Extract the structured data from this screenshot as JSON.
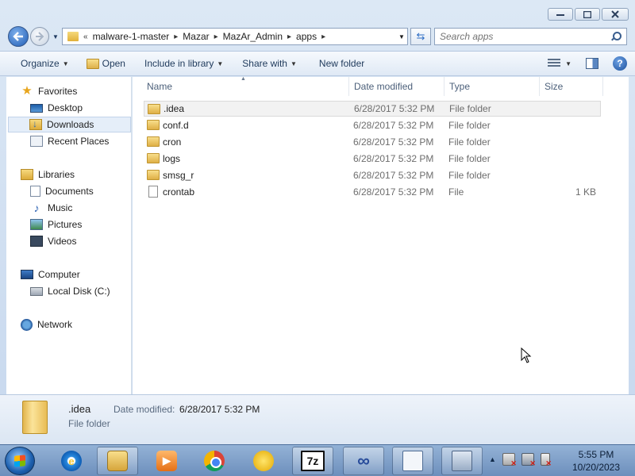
{
  "address": {
    "crumbs": [
      "malware-1-master",
      "Mazar",
      "MazAr_Admin",
      "apps"
    ],
    "overflow": "«"
  },
  "search": {
    "placeholder": "Search apps"
  },
  "toolbar": {
    "organize": "Organize",
    "open": "Open",
    "include_in_library": "Include in library",
    "share_with": "Share with",
    "new_folder": "New folder"
  },
  "navpane": {
    "favorites": "Favorites",
    "desktop": "Desktop",
    "downloads": "Downloads",
    "recent_places": "Recent Places",
    "libraries": "Libraries",
    "documents": "Documents",
    "music": "Music",
    "pictures": "Pictures",
    "videos": "Videos",
    "computer": "Computer",
    "local_disk": "Local Disk (C:)",
    "network": "Network"
  },
  "columns": {
    "name": "Name",
    "date_modified": "Date modified",
    "type": "Type",
    "size": "Size"
  },
  "files": [
    {
      "name": ".idea",
      "date": "6/28/2017 5:32 PM",
      "type": "File folder",
      "size": "",
      "icon": "folder-icon"
    },
    {
      "name": "conf.d",
      "date": "6/28/2017 5:32 PM",
      "type": "File folder",
      "size": "",
      "icon": "folder-icon"
    },
    {
      "name": "cron",
      "date": "6/28/2017 5:32 PM",
      "type": "File folder",
      "size": "",
      "icon": "folder-icon"
    },
    {
      "name": "logs",
      "date": "6/28/2017 5:32 PM",
      "type": "File folder",
      "size": "",
      "icon": "folder-icon"
    },
    {
      "name": "smsg_r",
      "date": "6/28/2017 5:32 PM",
      "type": "File folder",
      "size": "",
      "icon": "folder-icon"
    },
    {
      "name": "crontab",
      "date": "6/28/2017 5:32 PM",
      "type": "File",
      "size": "1 KB",
      "icon": "file-icon"
    }
  ],
  "details": {
    "name": ".idea",
    "type": "File folder",
    "date_label": "Date modified:",
    "date_value": "6/28/2017 5:32 PM"
  },
  "taskbar": {
    "time": "5:55 PM",
    "date": "10/20/2023"
  },
  "colors": {
    "accent": "#2b6cc4",
    "selection": "#e5eef9",
    "taskbar": "#7fa0c9"
  }
}
